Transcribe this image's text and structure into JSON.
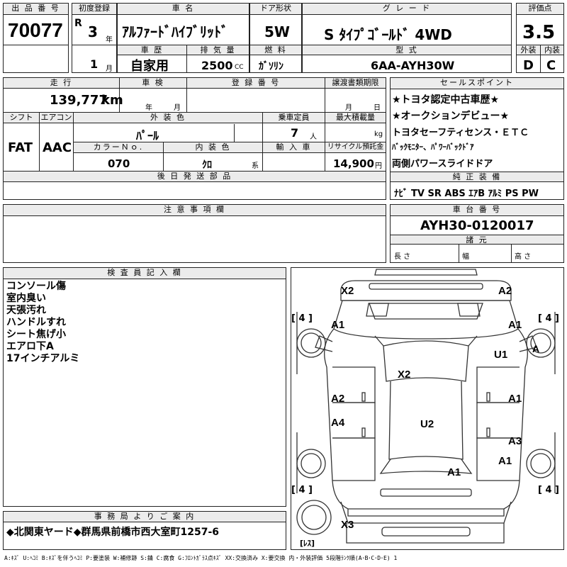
{
  "header": {
    "lot_label": "出 品 番 号",
    "lot_number": "70077",
    "first_reg_label": "初度登録",
    "era": "R",
    "year": "3",
    "year_unit": "年",
    "month": "1",
    "month_unit": "月",
    "name_label": "車 名",
    "name": "ｱﾙﾌｧｰﾄﾞﾊｲﾌﾞﾘｯﾄﾞ",
    "door_label": "ドア形状",
    "door": "5W",
    "grade_label": "グ レ ー ド",
    "grade": "S ﾀｲﾌﾟｺﾞｰﾙﾄﾞ 4WD",
    "score_label": "評価点",
    "score": "3.5",
    "history_label": "車 歴",
    "history": "自家用",
    "displacement_label": "排 気 量",
    "displacement": "2500",
    "displacement_unit": "CC",
    "fuel_label": "燃 料",
    "fuel": "ｶﾞｿﾘﾝ",
    "model_label": "型 式",
    "model": "6AA-AYH30W",
    "ext_label": "外装",
    "ext_score": "D",
    "int_label": "内装",
    "int_score": "C"
  },
  "details": {
    "mileage_label": "走 行",
    "mileage": "139,777",
    "mileage_unit": "km",
    "inspection_label": "車 検",
    "insp_year_unit": "年",
    "insp_month_unit": "月",
    "reg_label": "登 録 番 号",
    "transfer_label": "譲渡書類期限",
    "transfer_month_unit": "月",
    "transfer_day_unit": "日",
    "shift_label": "シフト",
    "shift": "FAT",
    "ac_label": "エアコン",
    "ac": "AAC",
    "color_label": "外 装 色",
    "color": "ﾊﾟｰﾙ",
    "capacity_label": "乗車定員",
    "capacity": "7",
    "capacity_unit": "人",
    "load_label": "最大積載量",
    "load_unit": "kg",
    "color_no_label": "カラーＮｏ.",
    "color_no": "070",
    "interior_label": "内 装 色",
    "interior": "ｸﾛ",
    "interior_unit": "系",
    "import_label": "輸 入 車",
    "recycle_label": "リサイクル預託金",
    "recycle": "14,900",
    "recycle_unit": "円",
    "later_label": "後 日 発 送 部 品"
  },
  "sales_points": {
    "label": "セールスポイント",
    "items": [
      "★トヨタ認定中古車歴★",
      "★オークションデビュー★",
      "トヨタセーフティセンス・ＥＴＣ",
      "ﾊﾞｯｸﾓﾆﾀｰ、ﾊﾟﾜｰﾊﾞｯｸﾄﾞｱ",
      "両側パワースライドドア"
    ]
  },
  "equipment": {
    "label": "純 正 装 備",
    "items": "ﾅﾋﾞ TV SR ABS ｴｱB ｱﾙﾐ PS PW"
  },
  "notes_section": {
    "label": "注 意 事 項 欄"
  },
  "chassis": {
    "label": "車 台 番 号",
    "number": "AYH30-0120017",
    "dims_label": "諸 元",
    "length": "長 さ",
    "width": "幅",
    "height": "高 さ"
  },
  "inspector": {
    "label": "検 査 員 記 入 欄",
    "notes": [
      "コンソール傷",
      "室内臭い",
      "天張汚れ",
      "ハンドルすれ",
      "シート焦げ小",
      "エアロ下A",
      "17インチアルミ"
    ]
  },
  "office": {
    "label": "事 務 局 よ り ご 案 内",
    "text": "◆北関東ヤード◆群馬県前橋市西大室町1257-6"
  },
  "diagram": {
    "tire_marks": [
      "[ 4 ]",
      "[ 4 ]",
      "[ 4 ]",
      "[ 4 ]"
    ],
    "spare_label": "[ﾚｽ]",
    "damage": [
      {
        "code": "X2"
      },
      {
        "code": "A2"
      },
      {
        "code": "A1"
      },
      {
        "code": "A1"
      },
      {
        "code": "A"
      },
      {
        "code": "U1"
      },
      {
        "code": "X2"
      },
      {
        "code": "A2"
      },
      {
        "code": "A1"
      },
      {
        "code": "A4"
      },
      {
        "code": "U2"
      },
      {
        "code": "A3"
      },
      {
        "code": "A1"
      },
      {
        "code": "A1"
      },
      {
        "code": "X3"
      }
    ]
  },
  "legend": "A:ｷｽﾞ U:ﾍｺﾐ B:ｷｽﾞを伴うﾍｺﾐ P:要塗装 W:補修跡 S:錆 C:腐食 G:ﾌﾛﾝﾄｶﾞﾗｽ点ｷｽﾞ XX:交換済み X:要交換 内・外装評価 5段階ﾗﾝｸ順(A･B･C･D･E) 1"
}
